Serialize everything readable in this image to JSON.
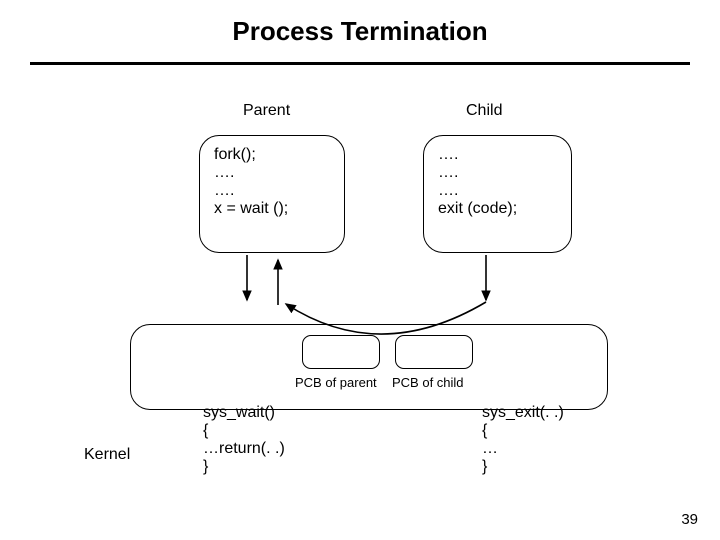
{
  "title": "Process Termination",
  "labels": {
    "parent": "Parent",
    "child": "Child",
    "kernel": "Kernel",
    "pcb_parent": "PCB of parent",
    "pcb_child": "PCB of child"
  },
  "parent_code": "fork();\n….\n….\nx = wait ();",
  "child_code": "….\n….\n….\nexit (code);",
  "sys_wait_code": "sys_wait()\n{\n…return(. .)\n}",
  "sys_exit_code": "sys_exit(. .)\n{\n…\n}",
  "page_number": "39"
}
